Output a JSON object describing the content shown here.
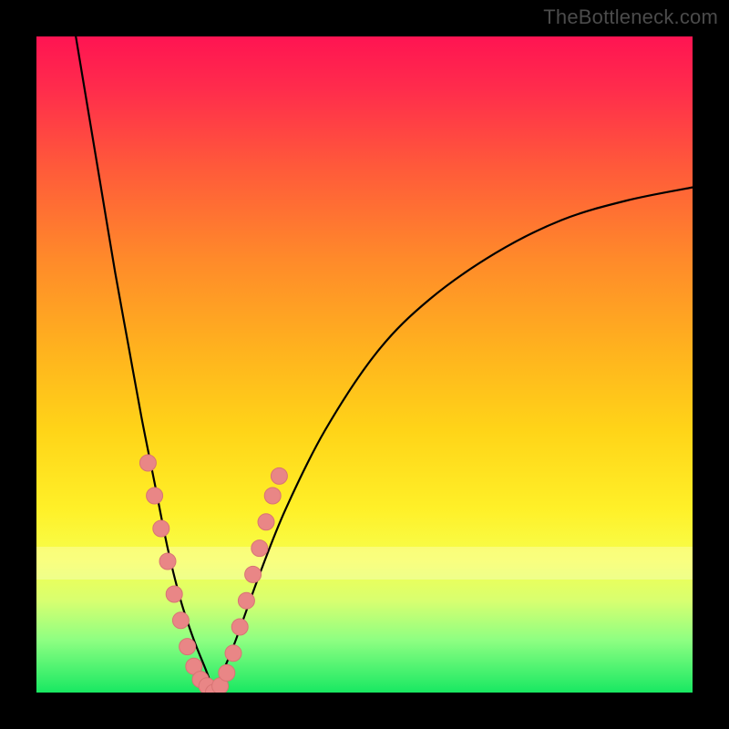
{
  "watermark_text": "TheBottleneck.com",
  "colors": {
    "curve": "#000000",
    "dot": "#e98686",
    "frame": "#000000"
  },
  "chart_data": {
    "type": "line",
    "title": "",
    "xlabel": "",
    "ylabel": "",
    "xlim": [
      0,
      100
    ],
    "ylim": [
      0,
      100
    ],
    "grid": false,
    "legend": false,
    "series": [
      {
        "name": "left-branch",
        "curve": "decreasing concave",
        "points": [
          {
            "x": 6,
            "y": 100
          },
          {
            "x": 8,
            "y": 88
          },
          {
            "x": 10,
            "y": 76
          },
          {
            "x": 12,
            "y": 64
          },
          {
            "x": 14,
            "y": 53
          },
          {
            "x": 16,
            "y": 42
          },
          {
            "x": 18,
            "y": 32
          },
          {
            "x": 20,
            "y": 22
          },
          {
            "x": 22,
            "y": 14
          },
          {
            "x": 24,
            "y": 8
          },
          {
            "x": 26,
            "y": 3
          },
          {
            "x": 27,
            "y": 0
          }
        ]
      },
      {
        "name": "right-branch",
        "curve": "increasing concave",
        "points": [
          {
            "x": 27,
            "y": 0
          },
          {
            "x": 30,
            "y": 7
          },
          {
            "x": 34,
            "y": 18
          },
          {
            "x": 38,
            "y": 28
          },
          {
            "x": 44,
            "y": 40
          },
          {
            "x": 52,
            "y": 52
          },
          {
            "x": 60,
            "y": 60
          },
          {
            "x": 70,
            "y": 67
          },
          {
            "x": 80,
            "y": 72
          },
          {
            "x": 90,
            "y": 75
          },
          {
            "x": 100,
            "y": 77
          }
        ]
      }
    ],
    "markers": [
      {
        "x": 17,
        "y": 35
      },
      {
        "x": 18,
        "y": 30
      },
      {
        "x": 19,
        "y": 25
      },
      {
        "x": 20,
        "y": 20
      },
      {
        "x": 21,
        "y": 15
      },
      {
        "x": 22,
        "y": 11
      },
      {
        "x": 23,
        "y": 7
      },
      {
        "x": 24,
        "y": 4
      },
      {
        "x": 25,
        "y": 2
      },
      {
        "x": 26,
        "y": 1
      },
      {
        "x": 27,
        "y": 0
      },
      {
        "x": 28,
        "y": 1
      },
      {
        "x": 29,
        "y": 3
      },
      {
        "x": 30,
        "y": 6
      },
      {
        "x": 31,
        "y": 10
      },
      {
        "x": 32,
        "y": 14
      },
      {
        "x": 33,
        "y": 18
      },
      {
        "x": 34,
        "y": 22
      },
      {
        "x": 35,
        "y": 26
      },
      {
        "x": 36,
        "y": 30
      },
      {
        "x": 37,
        "y": 33
      }
    ]
  }
}
